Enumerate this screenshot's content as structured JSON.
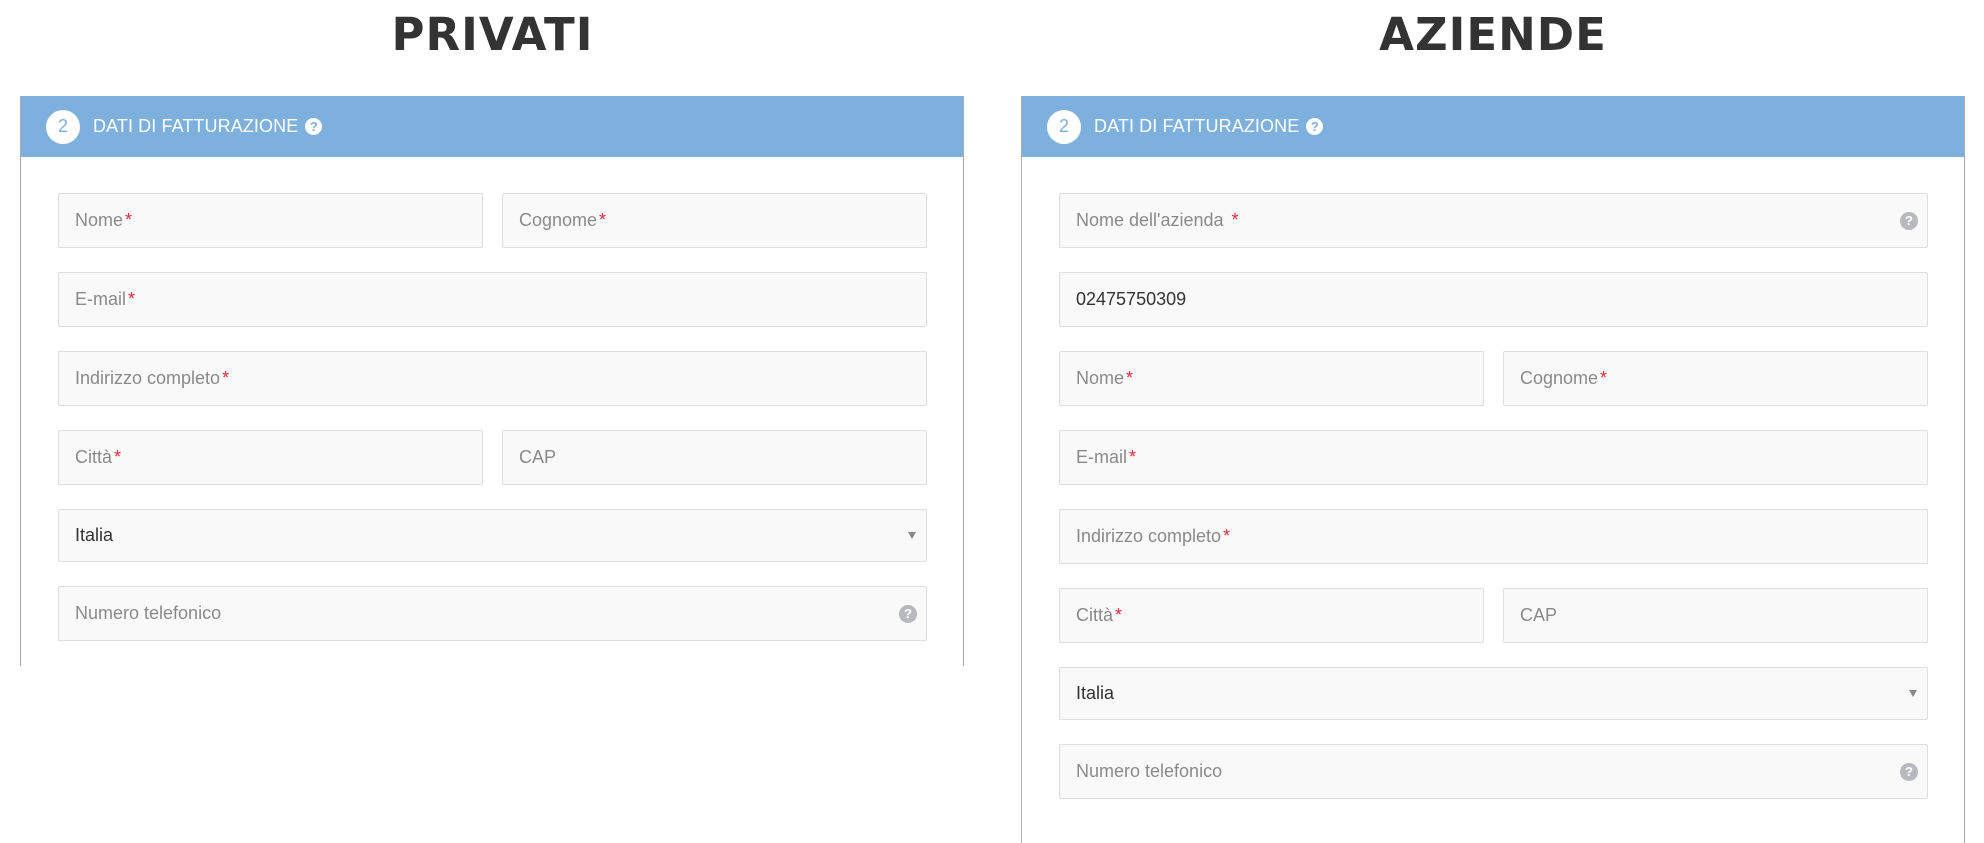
{
  "privati": {
    "title": "PRIVATI",
    "step_number": "2",
    "section_title": "DATI DI FATTURAZIONE",
    "help_glyph": "?",
    "fields": {
      "nome": {
        "placeholder": "Nome",
        "required": "*"
      },
      "cognome": {
        "placeholder": "Cognome",
        "required": "*"
      },
      "email": {
        "placeholder": "E-mail",
        "required": "*"
      },
      "indirizzo": {
        "placeholder": "Indirizzo completo",
        "required": "*"
      },
      "citta": {
        "placeholder": "Città",
        "required": "*"
      },
      "cap": {
        "placeholder": "CAP"
      },
      "paese": {
        "selected": "Italia"
      },
      "telefono": {
        "placeholder": "Numero telefonico"
      }
    }
  },
  "aziende": {
    "title": "AZIENDE",
    "step_number": "2",
    "section_title": "DATI DI FATTURAZIONE",
    "help_glyph": "?",
    "fields": {
      "nome_azienda": {
        "placeholder": "Nome dell'azienda",
        "required": "*"
      },
      "partita_iva": {
        "value": "02475750309"
      },
      "nome": {
        "placeholder": "Nome",
        "required": "*"
      },
      "cognome": {
        "placeholder": "Cognome",
        "required": "*"
      },
      "email": {
        "placeholder": "E-mail",
        "required": "*"
      },
      "indirizzo": {
        "placeholder": "Indirizzo completo",
        "required": "*"
      },
      "citta": {
        "placeholder": "Città",
        "required": "*"
      },
      "cap": {
        "placeholder": "CAP"
      },
      "paese": {
        "selected": "Italia"
      },
      "telefono": {
        "placeholder": "Numero telefonico"
      }
    }
  },
  "colors": {
    "header_bg": "#7eb0dd",
    "required_mark": "#e0293b",
    "field_bg": "#f9f9f9",
    "title_text": "#333333"
  },
  "icons": {
    "help": "question-circle-icon",
    "dropdown": "chevron-down-icon"
  }
}
